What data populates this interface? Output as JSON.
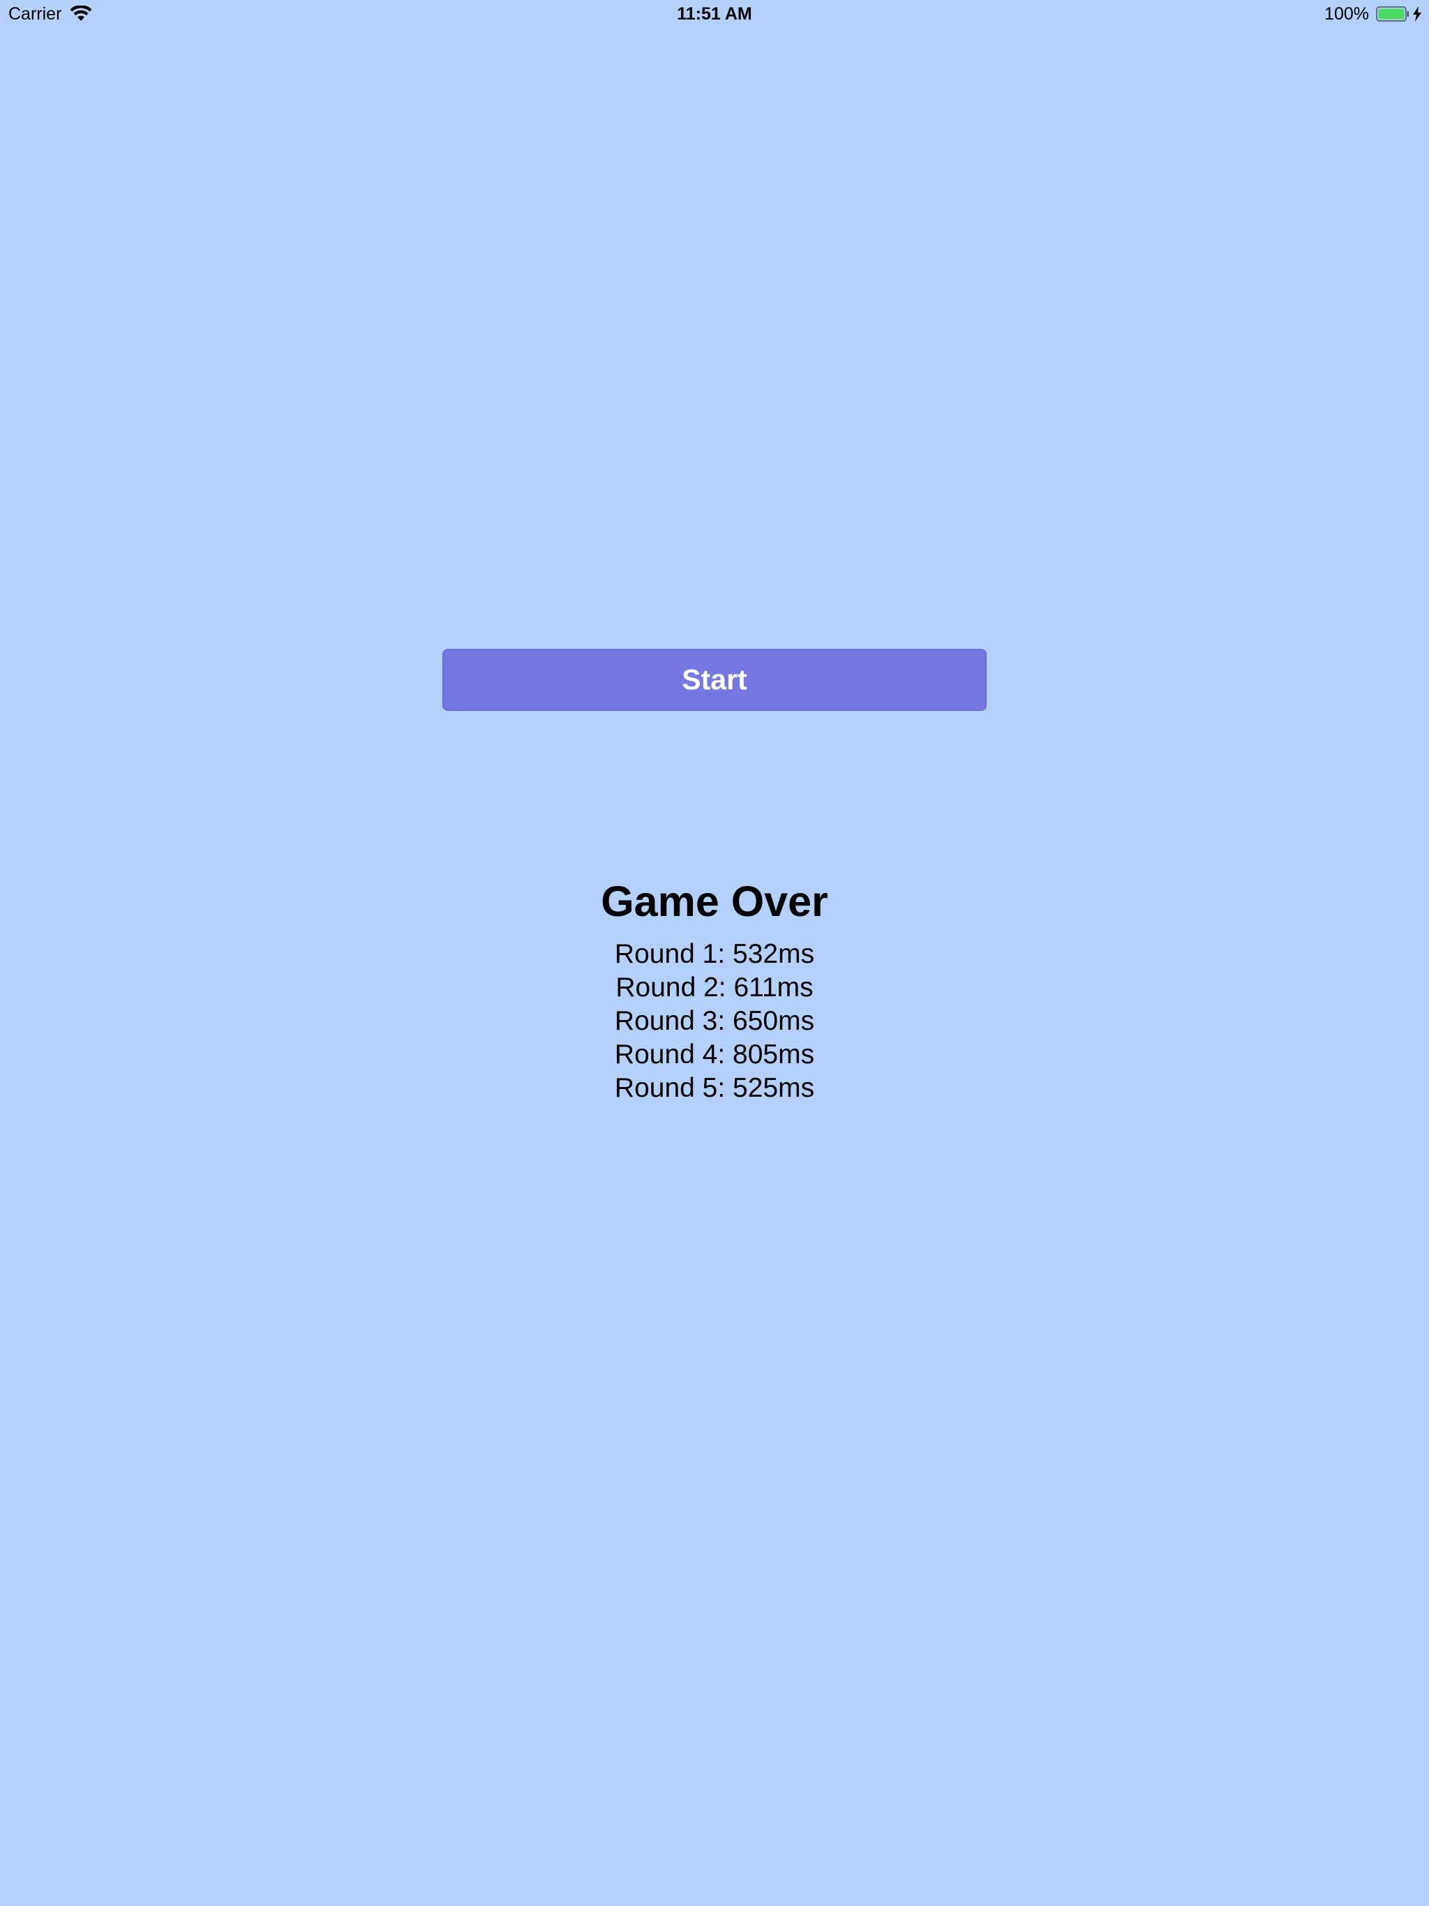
{
  "status_bar": {
    "carrier": "Carrier",
    "time": "11:51 AM",
    "battery_percent": "100%",
    "battery_color": "#4cd964"
  },
  "start_button": {
    "label": "Start",
    "color": "#7578e3"
  },
  "results": {
    "title": "Game Over",
    "rounds": [
      {
        "label": "Round 1: 532ms"
      },
      {
        "label": "Round 2: 611ms"
      },
      {
        "label": "Round 3: 650ms"
      },
      {
        "label": "Round 4: 805ms"
      },
      {
        "label": "Round 5: 525ms"
      }
    ]
  },
  "icons": {
    "wifi": "wifi-icon",
    "battery": "battery-icon",
    "charging": "charging-bolt-icon"
  },
  "background_color": "#b3d1fa"
}
